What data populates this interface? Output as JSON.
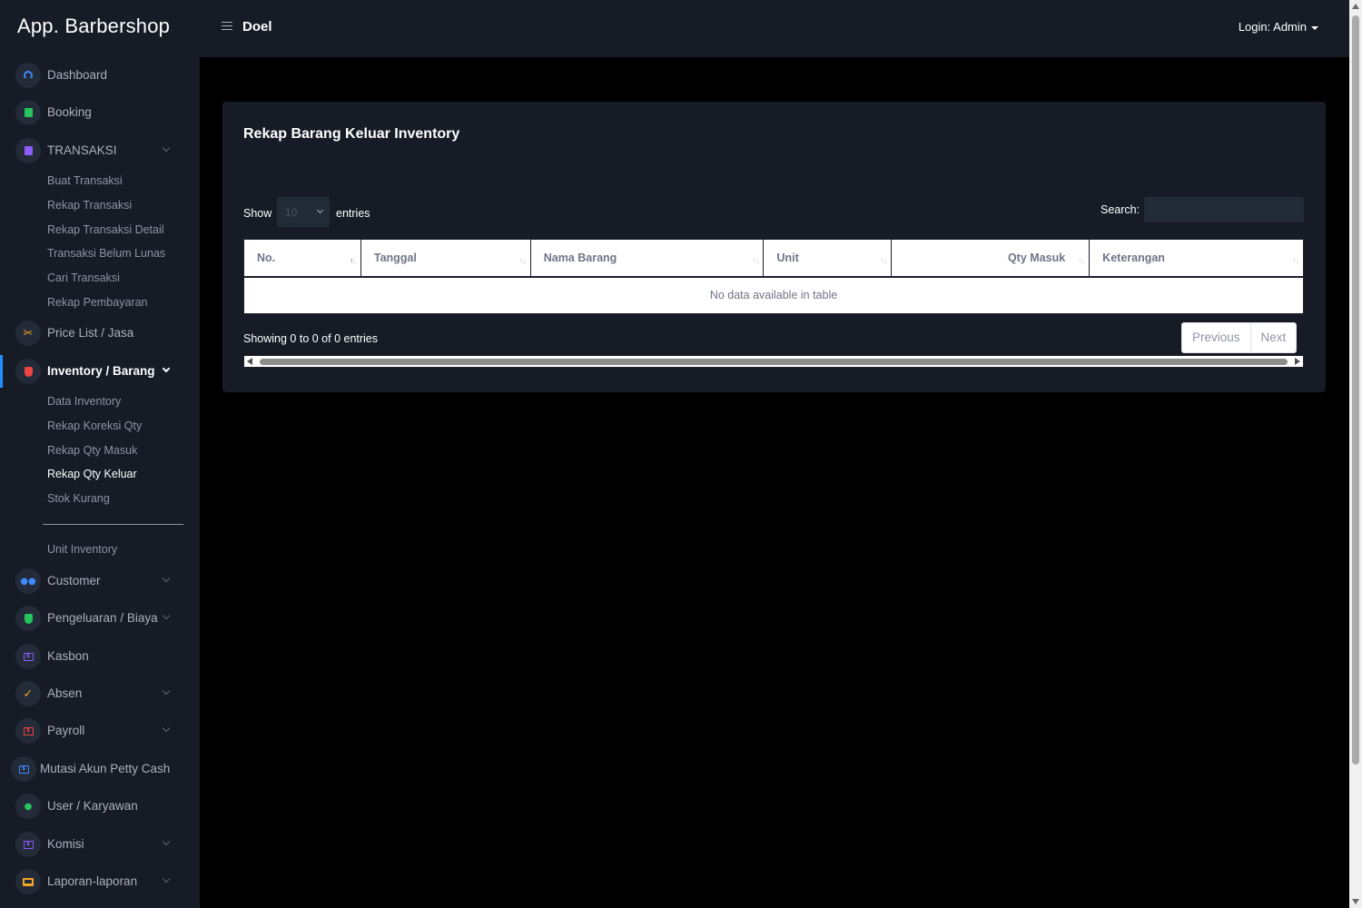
{
  "app": {
    "brand": "App. Barbershop",
    "page_title": "Doel",
    "login": "Login: Admin"
  },
  "sidebar": {
    "items": [
      {
        "label": "Dashboard",
        "icon": "gauge-icon"
      },
      {
        "label": "Booking",
        "icon": "note-icon"
      },
      {
        "label": "TRANSAKSI",
        "icon": "receipt-icon"
      },
      {
        "label": "Price List / Jasa",
        "icon": "scissors-icon"
      },
      {
        "label": "Inventory / Barang",
        "icon": "shield-icon"
      },
      {
        "label": "Customer",
        "icon": "users-icon"
      },
      {
        "label": "Pengeluaran / Biaya",
        "icon": "shield-check-icon"
      },
      {
        "label": "Kasbon",
        "icon": "money-icon"
      },
      {
        "label": "Absen",
        "icon": "check-icon"
      },
      {
        "label": "Payroll",
        "icon": "money-icon"
      },
      {
        "label": "Mutasi Akun Petty Cash",
        "icon": "money-icon"
      },
      {
        "label": "User / Karyawan",
        "icon": "user-icon"
      },
      {
        "label": "Komisi",
        "icon": "money-icon"
      },
      {
        "label": "Laporan-laporan",
        "icon": "laptop-icon"
      }
    ],
    "transaksi_sub": [
      "Buat Transaksi",
      "Rekap Transaksi",
      "Rekap Transaksi Detail",
      "Transaksi Belum Lunas",
      "Cari Transaksi",
      "Rekap Pembayaran"
    ],
    "inventory_sub": [
      "Data Inventory",
      "Rekap Koreksi Qty",
      "Rekap Qty Masuk",
      "Rekap Qty Keluar",
      "Stok Kurang"
    ],
    "inventory_sub2": [
      "Unit Inventory"
    ],
    "active_item": "Inventory / Barang",
    "current_sub": "Rekap Qty Keluar"
  },
  "card": {
    "title": "Rekap Barang Keluar Inventory",
    "show_label": "Show",
    "page_length": "10",
    "entries_label": "entries",
    "search_label": "Search:",
    "search_value": "",
    "columns": [
      "No.",
      "Tanggal",
      "Nama Barang",
      "Unit",
      "Qty Masuk",
      "Keterangan"
    ],
    "empty_message": "No data available in table",
    "info": "Showing 0 to 0 of 0 entries",
    "prev": "Previous",
    "next": "Next"
  },
  "colors": {
    "background": "#000000",
    "panel": "#161b26",
    "accent": "#1e90ff"
  }
}
